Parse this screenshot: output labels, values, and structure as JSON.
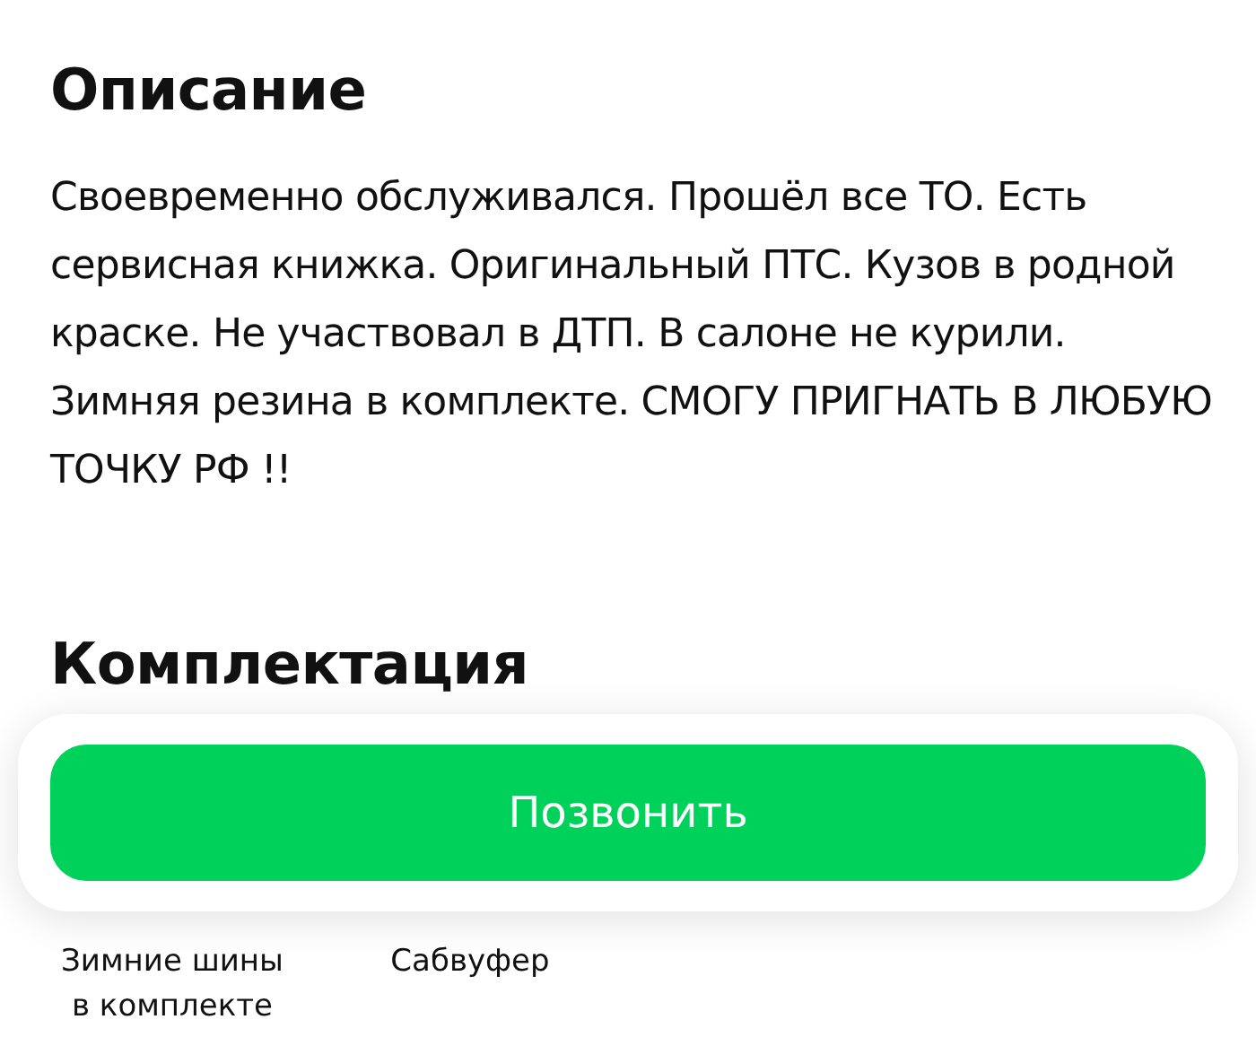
{
  "description": {
    "title": "Описание",
    "text": "Своевременно обслуживался. Прошёл все ТО. Есть сервисная книжка. Оригинальный ПТС. Кузов в родной краске. Не участвовал в ДТП. В салоне не курили. Зимняя резина в комплекте. СМОГУ ПРИГНАТЬ В ЛЮБУЮ ТОЧКУ РФ !!"
  },
  "equipment": {
    "title": "Комплектация",
    "items": [
      {
        "label": "Зимние шины в комплекте"
      },
      {
        "label": "Сабвуфер"
      }
    ]
  },
  "call_button": {
    "label": "Позвонить"
  }
}
